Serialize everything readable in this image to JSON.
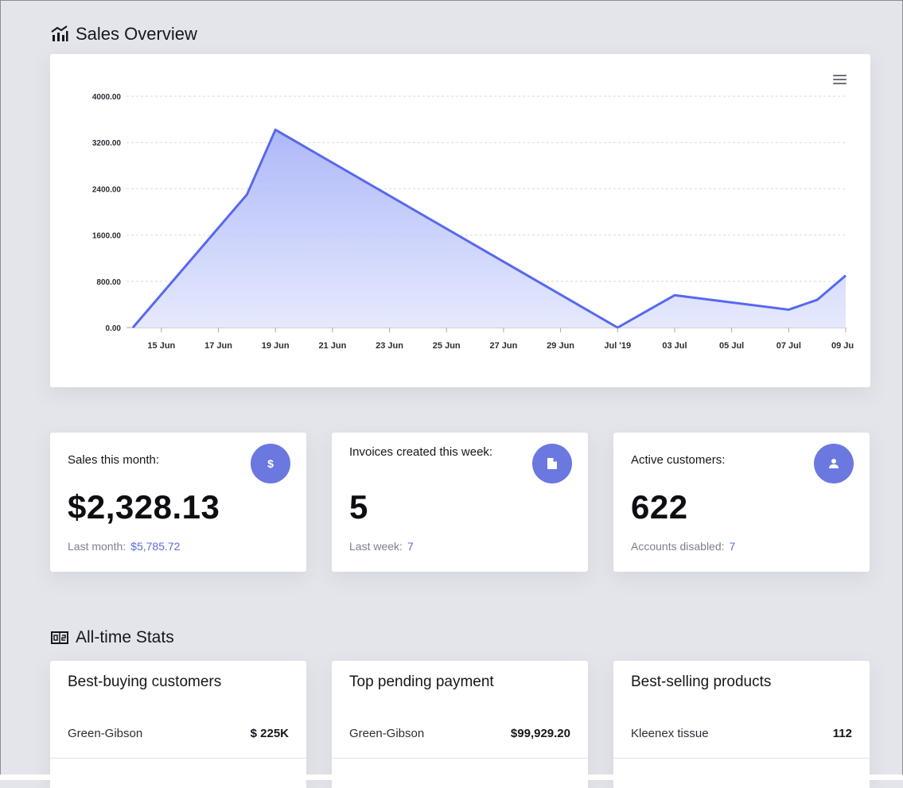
{
  "sections": {
    "sales_overview": "Sales Overview",
    "all_time_stats": "All-time Stats"
  },
  "chart_data": {
    "type": "area",
    "x": [
      "2019-06-14",
      "2019-06-18",
      "2019-06-19",
      "2019-07-01",
      "2019-07-03",
      "2019-07-07",
      "2019-07-08",
      "2019-07-09"
    ],
    "values": [
      0,
      2300,
      3420,
      0,
      560,
      310,
      480,
      900
    ],
    "ylim": [
      0,
      4000
    ],
    "y_ticks": [
      "0.00",
      "800.00",
      "1600.00",
      "2400.00",
      "3200.00",
      "4000.00"
    ],
    "x_ticks": [
      "15 Jun",
      "17 Jun",
      "19 Jun",
      "21 Jun",
      "23 Jun",
      "25 Jun",
      "27 Jun",
      "29 Jun",
      "Jul '19",
      "03 Jul",
      "05 Jul",
      "07 Jul",
      "09 Ju"
    ],
    "grid": true,
    "line_color": "#5768ee",
    "fill_color": "#b7c0fa"
  },
  "stats": [
    {
      "label": "Sales this month:",
      "value": "$2,328.13",
      "sub_label": "Last month:",
      "sub_value": "$5,785.72",
      "icon": "dollar-icon"
    },
    {
      "label": "Invoices created this week:",
      "value": "5",
      "sub_label": "Last week:",
      "sub_value": "7",
      "icon": "document-icon"
    },
    {
      "label": "Active customers:",
      "value": "622",
      "sub_label": "Accounts disabled:",
      "sub_value": "7",
      "icon": "user-icon"
    }
  ],
  "lists": [
    {
      "title": "Best-buying customers",
      "rows": [
        {
          "name": "Green-Gibson",
          "value": "$ 225K"
        }
      ]
    },
    {
      "title": "Top pending payment",
      "rows": [
        {
          "name": "Green-Gibson",
          "value": "$99,929.20"
        }
      ]
    },
    {
      "title": "Best-selling products",
      "rows": [
        {
          "name": "Kleenex tissue",
          "value": "112"
        }
      ]
    }
  ],
  "colors": {
    "accent": "#6a78e0",
    "link": "#5a6ade",
    "background": "#e4e5ea"
  }
}
